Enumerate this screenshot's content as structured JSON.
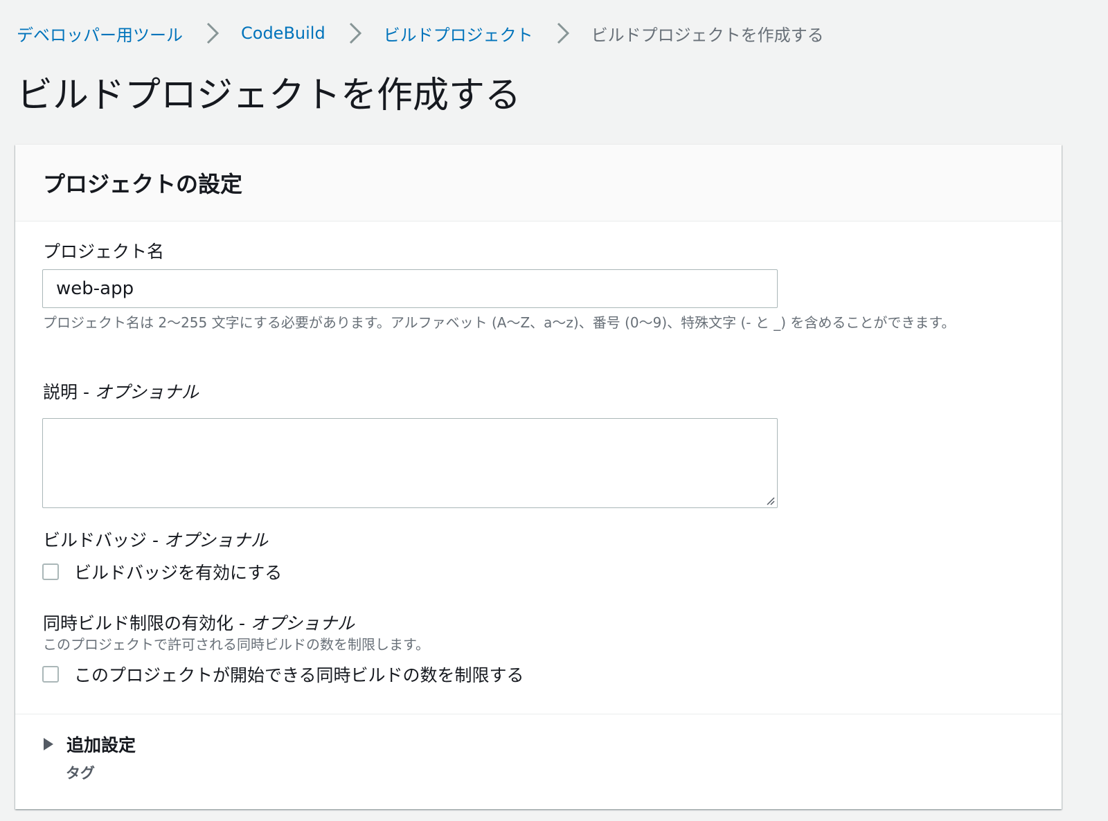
{
  "breadcrumb": {
    "items": [
      {
        "label": "デベロッパー用ツール"
      },
      {
        "label": "CodeBuild"
      },
      {
        "label": "ビルドプロジェクト"
      }
    ],
    "current": "ビルドプロジェクトを作成する",
    "separator_icon": "chevron-right-icon"
  },
  "page": {
    "title": "ビルドプロジェクトを作成する"
  },
  "panel": {
    "title": "プロジェクトの設定"
  },
  "project_name": {
    "label": "プロジェクト名",
    "value": "web-app",
    "constraint": "プロジェクト名は 2〜255 文字にする必要があります。アルファベット (A〜Z、a〜z)、番号 (0〜9)、特殊文字 (- と _) を含めることができます。"
  },
  "description": {
    "label": "説明 - ",
    "optional": "オプショナル",
    "value": ""
  },
  "build_badge": {
    "label": "ビルドバッジ - ",
    "optional": "オプショナル",
    "checkbox_label": "ビルドバッジを有効にする",
    "checked": false
  },
  "concurrent_limit": {
    "label": "同時ビルド制限の有効化 - ",
    "optional": "オプショナル",
    "description": "このプロジェクトで許可される同時ビルドの数を制限します。",
    "checkbox_label": "このプロジェクトが開始できる同時ビルドの数を制限する",
    "checked": false
  },
  "additional": {
    "title": "追加設定",
    "description": "タグ",
    "expanded": false,
    "icon": "caret-right-icon"
  },
  "colors": {
    "link": "#0073bb",
    "text": "#16191f",
    "muted": "#687078",
    "background": "#f2f3f3",
    "border": "#aab7b8"
  }
}
